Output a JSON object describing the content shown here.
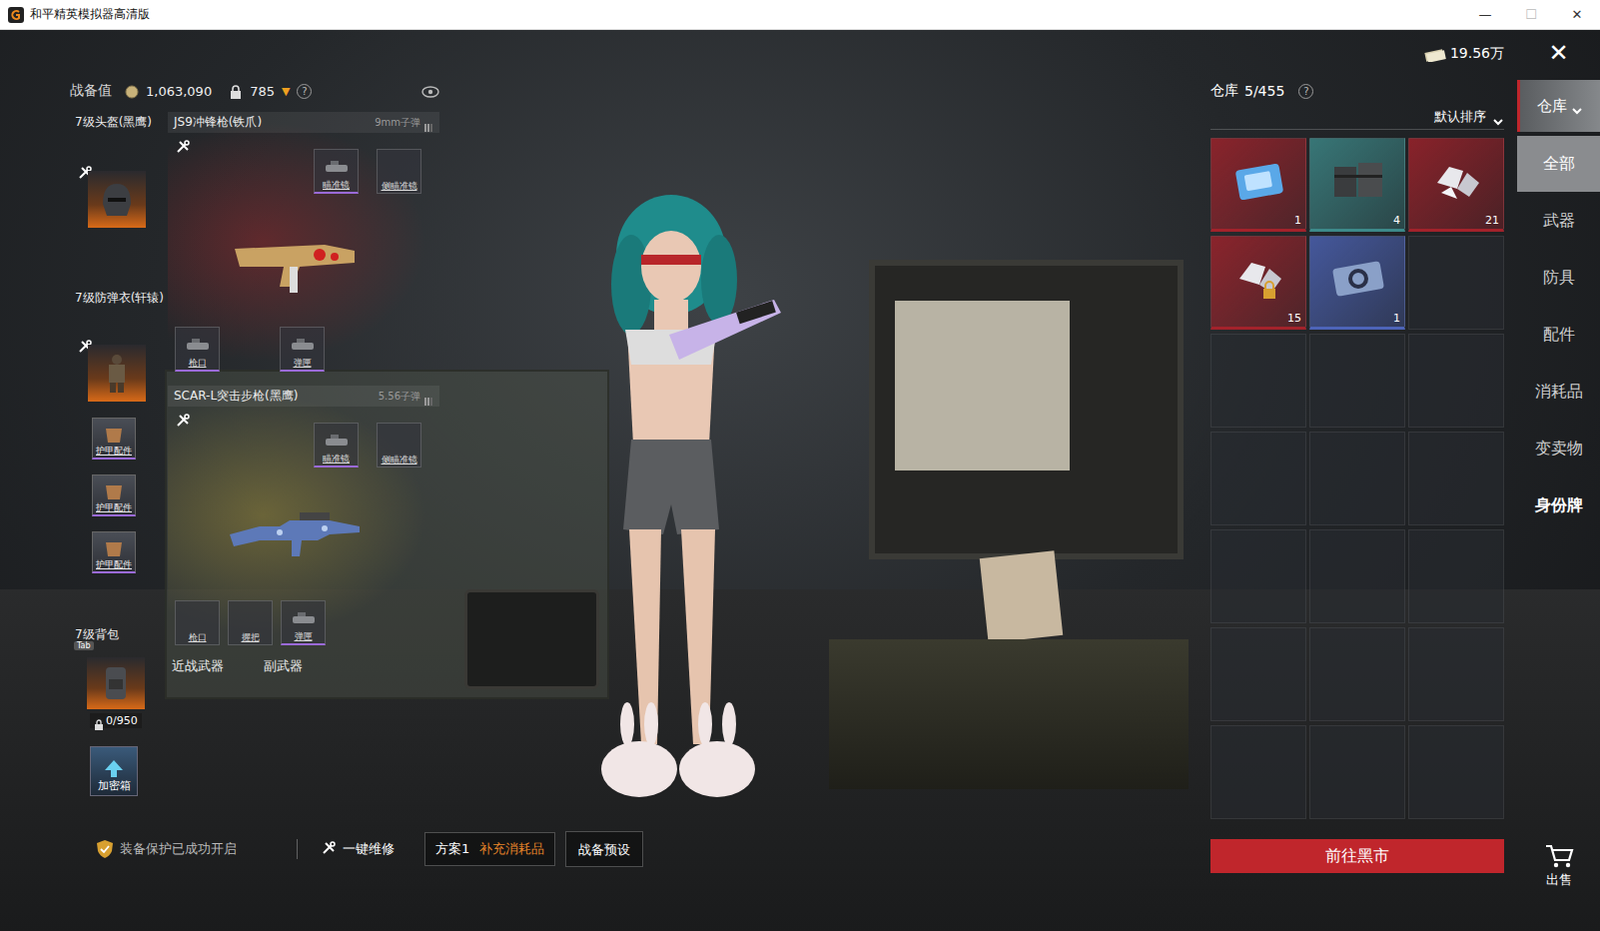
{
  "window": {
    "title": "和平精英模拟器高清版",
    "controls": [
      {
        "glyph": "—",
        "disabled": false
      },
      {
        "glyph": "☐",
        "disabled": true
      },
      {
        "glyph": "✕",
        "disabled": false
      }
    ]
  },
  "header": {
    "label": "战备值",
    "value": "1,063,090",
    "locked": "785",
    "arrow": "▼",
    "help": "?"
  },
  "gear": [
    {
      "label": "7级头盔(黑鹰)",
      "kind": "helmet"
    },
    {
      "label": "7级防弹衣(轩辕)",
      "kind": "armor"
    }
  ],
  "armor_parts": [
    {
      "label": "护甲配件"
    },
    {
      "label": "护甲配件"
    },
    {
      "label": "护甲配件"
    }
  ],
  "backpack": {
    "label": "7级背包",
    "key": "Tab",
    "capacity": "0/950"
  },
  "safe_box": {
    "label": "加密箱"
  },
  "weapons": [
    {
      "name": "JS9冲锋枪(铁爪)",
      "ammo": "9mm子弹",
      "color": "#b3262a",
      "skin_color": "#c9a263",
      "top_slots": [
        {
          "label": "瞄准镜",
          "filled": true
        },
        {
          "label": "侧瞄准镜",
          "filled": false
        }
      ],
      "bottom_slots": [
        {
          "label": "枪口",
          "filled": true
        },
        {
          "label": "弹匣",
          "filled": true
        }
      ]
    },
    {
      "name": "SCAR-L突击步枪(黑鹰)",
      "ammo": "5.56子弹",
      "color": "#b8a03a",
      "skin_color": "#5d79b8",
      "top_slots": [
        {
          "label": "瞄准镜",
          "filled": true
        },
        {
          "label": "侧瞄准镜",
          "filled": false
        }
      ],
      "bottom_slots": [
        {
          "label": "枪口",
          "filled": false
        },
        {
          "label": "握把",
          "filled": false
        },
        {
          "label": "弹匣",
          "filled": true
        }
      ]
    }
  ],
  "extra_slots": [
    {
      "label": "近战武器"
    },
    {
      "label": "副武器"
    }
  ],
  "bottom_bar": {
    "protection": "装备保护已成功开启",
    "repair": "一键维修",
    "plan": "方案1",
    "restock": "补充消耗品",
    "presets": "战备预设"
  },
  "currency": {
    "value": "19.56万"
  },
  "warehouse": {
    "title": "仓库",
    "count": "5/455",
    "help": "?",
    "sort": "默认排序",
    "items": [
      {
        "kind": "ticket",
        "count": "1",
        "color": "#a3222b"
      },
      {
        "kind": "crate",
        "count": "4",
        "color": "#3d8a8a"
      },
      {
        "kind": "gems",
        "count": "21",
        "color": "#a3222b"
      },
      {
        "kind": "locked-gems",
        "count": "15",
        "color": "#a3222b"
      },
      {
        "kind": "gear-ticket",
        "count": "1",
        "color": "#4d64b8"
      }
    ]
  },
  "market_button": "前往黑市",
  "sidebar": {
    "close": "✕",
    "dropdown": {
      "label": "仓库",
      "selected": true
    },
    "items": [
      {
        "label": "全部",
        "selected": true,
        "highlighted": false
      },
      {
        "label": "武器",
        "selected": false,
        "highlighted": false
      },
      {
        "label": "防具",
        "selected": false,
        "highlighted": false
      },
      {
        "label": "配件",
        "selected": false,
        "highlighted": false
      },
      {
        "label": "消耗品",
        "selected": false,
        "highlighted": false
      },
      {
        "label": "变卖物",
        "selected": false,
        "highlighted": false
      },
      {
        "label": "身份牌",
        "selected": false,
        "highlighted": true
      }
    ],
    "sell": "出售"
  }
}
